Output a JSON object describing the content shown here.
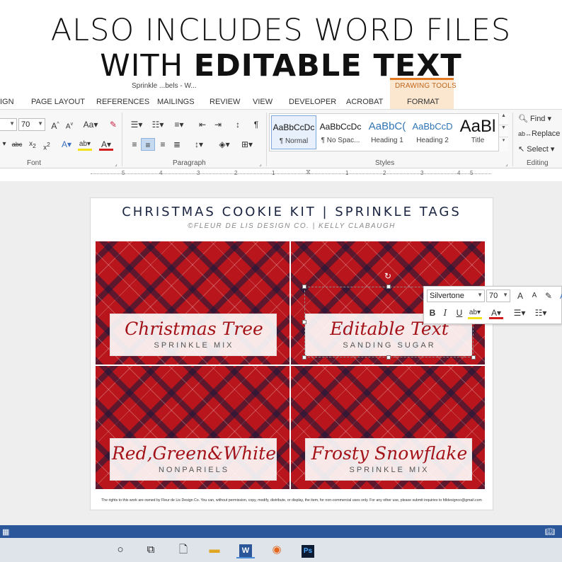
{
  "promo": {
    "line1": "ALSO INCLUDES WORD FILES",
    "line2_prefix": "WITH ",
    "line2_bold": "EDITABLE TEXT"
  },
  "window": {
    "doc_title": "Sprinkle ...bels - W...",
    "contextual_tab_group": "DRAWING TOOLS"
  },
  "tabs": [
    "IGN",
    "PAGE LAYOUT",
    "REFERENCES",
    "MAILINGS",
    "REVIEW",
    "VIEW",
    "DEVELOPER",
    "ACROBAT",
    "FORMAT"
  ],
  "ribbon": {
    "font_size": "70",
    "groups": [
      "Font",
      "Paragraph",
      "Styles",
      "Editing"
    ],
    "styles": [
      {
        "sample": "AaBbCcDc",
        "name": "¶ Normal"
      },
      {
        "sample": "AaBbCcDc",
        "name": "¶ No Spac..."
      },
      {
        "sample": "AaBbC(",
        "name": "Heading 1"
      },
      {
        "sample": "AaBbCcD",
        "name": "Heading 2"
      },
      {
        "sample": "AaBl",
        "name": "Title"
      }
    ],
    "editing": {
      "find": "Find",
      "replace": "Replace",
      "select": "Select"
    }
  },
  "ruler": {
    "numbers": [
      "5",
      "4",
      "3",
      "2",
      "1",
      "1",
      "2",
      "3",
      "4",
      "5"
    ]
  },
  "document": {
    "title": "CHRISTMAS COOKIE KIT | SPRINKLE TAGS",
    "subtitle": "©FLEUR DE LIS DESIGN CO. | KELLY CLABAUGH",
    "tags": [
      {
        "script": "Christmas Tree",
        "sub": "SPRINKLE MIX"
      },
      {
        "script": "Editable Text",
        "sub": "SANDING SUGAR"
      },
      {
        "script": "Red,Green&White",
        "sub": "NONPARIELS"
      },
      {
        "script": "Frosty Snowflake",
        "sub": "SPRINKLE MIX"
      }
    ],
    "copyright": "The rights to this work are owned by Fleur de Lis Design Co. You can, without permission, copy, modify, distribute, or display, the item, for non-commercial uses only. For any other use, please submit inquiries to fdldesignco@gmail.com"
  },
  "mini_toolbar": {
    "font": "Silvertone",
    "size": "70"
  },
  "colors": {
    "word_blue": "#2b579a",
    "plaid_red": "#b8161c",
    "drawing_tools_orange": "#e07b24"
  }
}
